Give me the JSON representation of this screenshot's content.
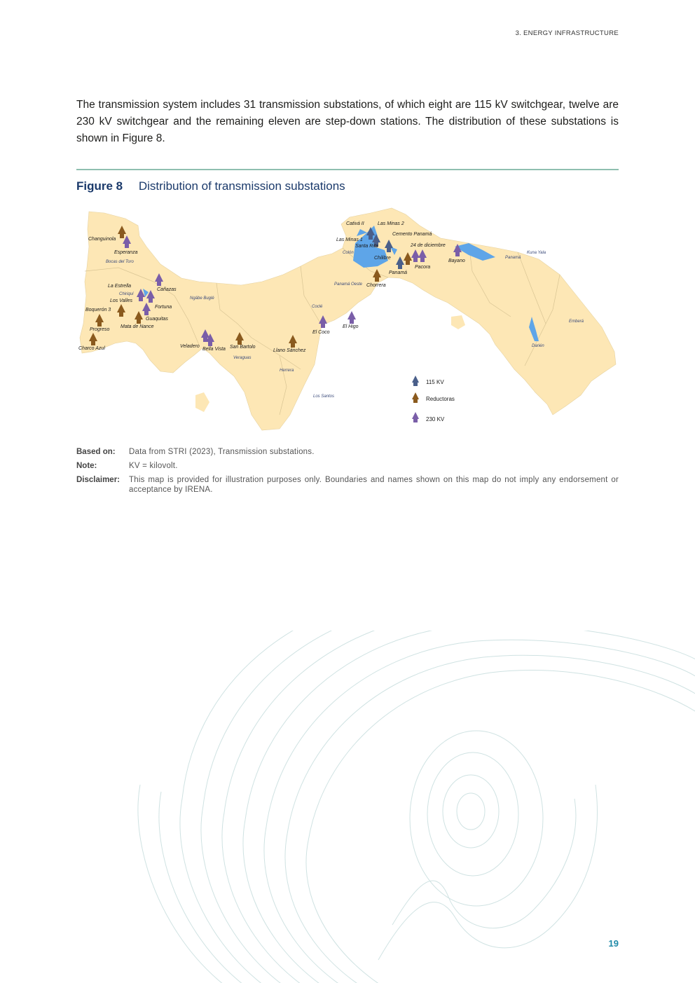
{
  "header": {
    "section": "3. ENERGY INFRASTRUCTURE"
  },
  "body": {
    "paragraph": "The transmission system includes 31 transmission substations, of which eight are 115 kV switchgear, twelve are 230 kV switchgear and the remaining eleven are step-down stations. The distribution of these substations is shown in Figure 8."
  },
  "figure": {
    "label": "Figure 8",
    "caption": "Distribution of transmission substations"
  },
  "map": {
    "colors": {
      "land": "#fde7b5",
      "water": "#5ea5e8",
      "border": "#d7c59a",
      "t115": "#4a5f8a",
      "reductoras": "#8a5a1e",
      "t230": "#7a5ea8"
    },
    "substations": [
      {
        "name": "Changuinola",
        "type": "reductoras"
      },
      {
        "name": "Esperanza",
        "type": "230"
      },
      {
        "name": "La Estrella",
        "type": "230"
      },
      {
        "name": "Cañazas",
        "type": "230"
      },
      {
        "name": "Los Valles",
        "type": "230"
      },
      {
        "name": "Fortuna",
        "type": "230"
      },
      {
        "name": "Guaquitas",
        "type": "reductoras"
      },
      {
        "name": "Boquerón 3",
        "type": "reductoras"
      },
      {
        "name": "Mata de Nance",
        "type": "reductoras"
      },
      {
        "name": "Progreso",
        "type": "reductoras"
      },
      {
        "name": "Charco Azul",
        "type": "reductoras"
      },
      {
        "name": "Veladero",
        "type": "230"
      },
      {
        "name": "Bella Vista",
        "type": "230"
      },
      {
        "name": "San Bartolo",
        "type": "reductoras"
      },
      {
        "name": "Llano Sánchez",
        "type": "reductoras"
      },
      {
        "name": "El Coco",
        "type": "230"
      },
      {
        "name": "El Higo",
        "type": "230"
      },
      {
        "name": "Chorrera",
        "type": "reductoras"
      },
      {
        "name": "Cativá II",
        "type": "115"
      },
      {
        "name": "Las Minas 2",
        "type": "115"
      },
      {
        "name": "Las Minas 1",
        "type": "115"
      },
      {
        "name": "Santa Rita",
        "type": "115"
      },
      {
        "name": "Cemento Panamá",
        "type": "115"
      },
      {
        "name": "Chilibre",
        "type": "115"
      },
      {
        "name": "24 de diciembre",
        "type": "230"
      },
      {
        "name": "Panamá",
        "type": "reductoras"
      },
      {
        "name": "Pacora",
        "type": "230"
      },
      {
        "name": "Bayano",
        "type": "230"
      }
    ],
    "region_labels": [
      "Bocas del Toro",
      "Chiriquí",
      "Ngäbe Buglé",
      "Coclé",
      "Colón",
      "Panamá Oeste",
      "Veraguas",
      "Herrera",
      "Los Santos",
      "Panamá",
      "Kuna Yala",
      "Emberá",
      "Darién"
    ],
    "legend": {
      "k115": "115 KV",
      "reductoras": "Reductoras",
      "k230": "230 KV"
    }
  },
  "notes": {
    "based_on_label": "Based on:",
    "based_on": "Data from STRI (2023), Transmission substations.",
    "note_label": "Note:",
    "note": "KV = kilovolt.",
    "disclaimer_label": "Disclaimer:",
    "disclaimer": "This map is provided for illustration purposes only. Boundaries and names shown on this map do not imply any endorsement or acceptance by IRENA."
  },
  "page_number": "19"
}
